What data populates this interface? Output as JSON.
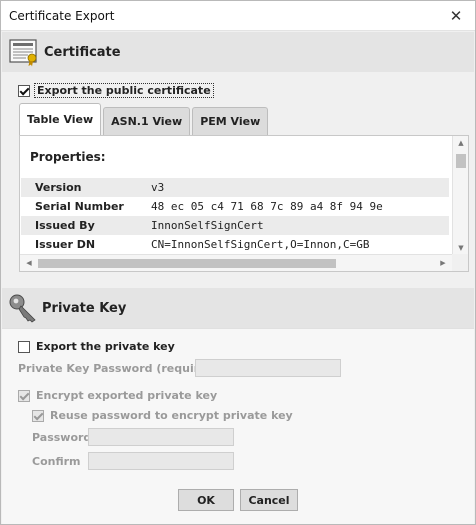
{
  "window": {
    "title": "Certificate Export",
    "close_glyph": "✕"
  },
  "certificate_section": {
    "title": "Certificate",
    "icon": "certificate-icon"
  },
  "export_public": {
    "label": "Export the public certificate",
    "checked": true
  },
  "tabs": [
    {
      "label": "Table View",
      "active": true
    },
    {
      "label": "ASN.1 View",
      "active": false
    },
    {
      "label": "PEM View",
      "active": false
    }
  ],
  "properties": {
    "title": "Properties:",
    "rows": [
      {
        "key": "Version",
        "value": "v3"
      },
      {
        "key": "Serial Number",
        "value": "48 ec 05 c4 71 68 7c 89 a4 8f 94 9e"
      },
      {
        "key": "Issued By",
        "value": "InnonSelfSignCert"
      },
      {
        "key": "Issuer DN",
        "value": "CN=InnonSelfSignCert,O=Innon,C=GB"
      }
    ]
  },
  "private_key_section": {
    "title": "Private Key",
    "icon": "key-icon"
  },
  "export_private": {
    "label": "Export the private key",
    "checked": false
  },
  "private_key_password": {
    "label": "Private Key Password (required):",
    "value": ""
  },
  "encrypt_exported": {
    "label": "Encrypt exported private key",
    "checked": true
  },
  "reuse_password": {
    "label": "Reuse password to encrypt private key",
    "checked": true
  },
  "password": {
    "label": "Password",
    "value": ""
  },
  "confirm": {
    "label": "Confirm",
    "value": ""
  },
  "buttons": {
    "ok": "OK",
    "cancel": "Cancel"
  },
  "colors": {
    "header_bg": "#e4e4e4",
    "panel_bg": "#f0f0f0",
    "disabled_text": "#9a9a9a"
  }
}
